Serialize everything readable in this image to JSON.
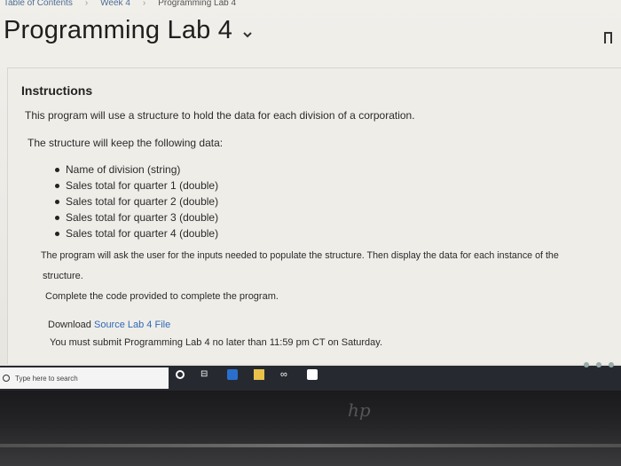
{
  "breadcrumb": {
    "items": [
      "Table of Contents",
      "Week 4",
      "Programming Lab 4"
    ],
    "separator": "›"
  },
  "page": {
    "title": "Programming Lab 4",
    "title_dropdown_icon": "chevron-down-icon",
    "bookmark_icon": "bookmark-icon"
  },
  "content": {
    "heading": "Instructions",
    "intro": "This program will use a structure to hold the data for each division of a corporation.",
    "structure_intro": "The structure will keep the following data:",
    "bullets": [
      "Name of division (string)",
      "Sales total for quarter 1 (double)",
      "Sales total for quarter 2 (double)",
      "Sales total for quarter 3 (double)",
      "Sales total for quarter 4 (double)"
    ],
    "program_line1": "The program will ask the user for the inputs needed to populate the structure. Then display the data for each instance of the",
    "program_line2": "structure.",
    "complete": "Complete the code provided to complete the program.",
    "download_prefix": "Download",
    "download_link": "Source Lab 4 File",
    "submit": "You must submit Programming Lab 4 no later than 11:59 pm CT on Saturday."
  },
  "taskbar": {
    "search_placeholder": "Type here to search",
    "icons": [
      "cortana-icon",
      "task-view-icon",
      "edge-icon",
      "file-explorer-icon",
      "infinity-app-icon",
      "mail-icon"
    ]
  },
  "colors": {
    "link": "#2f6ab8",
    "taskbar": "#262a30",
    "page_bg": "#efede8"
  }
}
